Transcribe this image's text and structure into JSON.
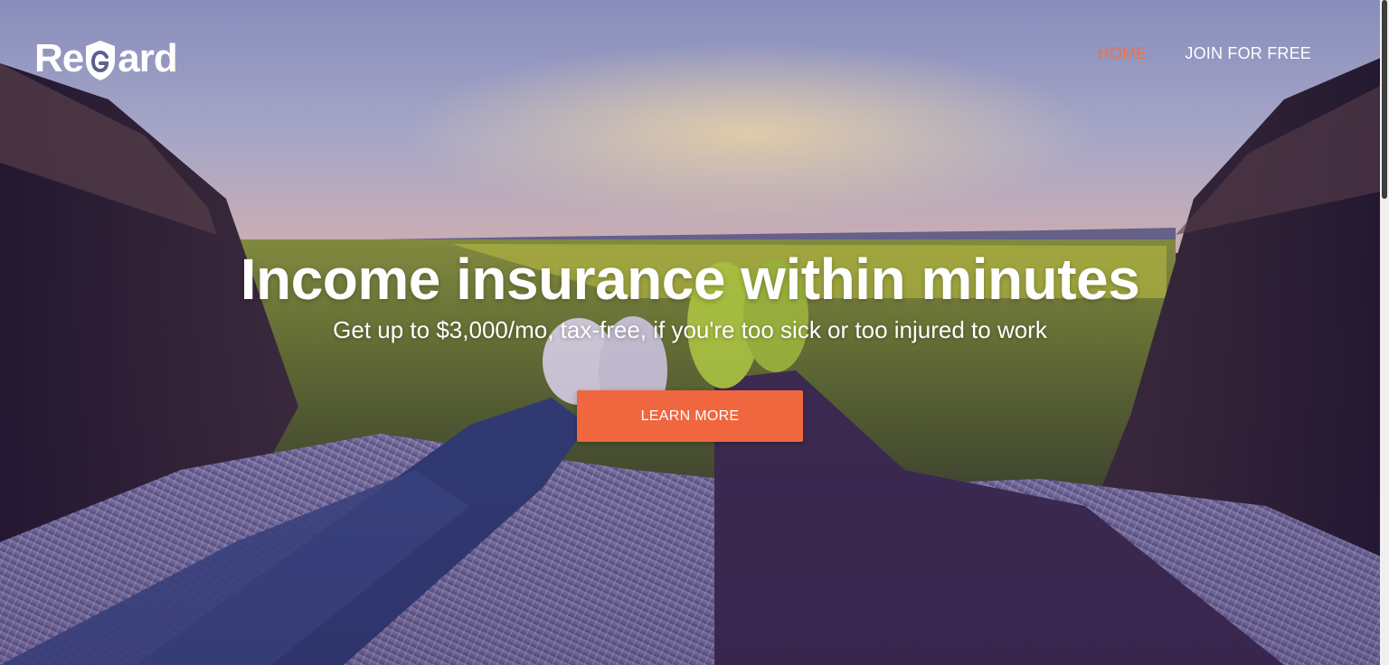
{
  "header": {
    "logo_text": "ReGard",
    "nav": [
      {
        "label": "HOME",
        "active": true
      },
      {
        "label": "JOIN FOR FREE",
        "active": false
      }
    ]
  },
  "hero": {
    "title": "Income insurance within minutes",
    "subtitle": "Get up to $3,000/mo, tax-free, if you're too sick or too injured to work",
    "cta_label": "LEARN MORE",
    "background": "photo of two people's legs resting in an open car trunk overlooking a sunset field"
  },
  "colors": {
    "accent": "#f0673f",
    "nav_active": "#f07048",
    "text": "#ffffff"
  },
  "icons": [
    "shield-logo-icon"
  ]
}
